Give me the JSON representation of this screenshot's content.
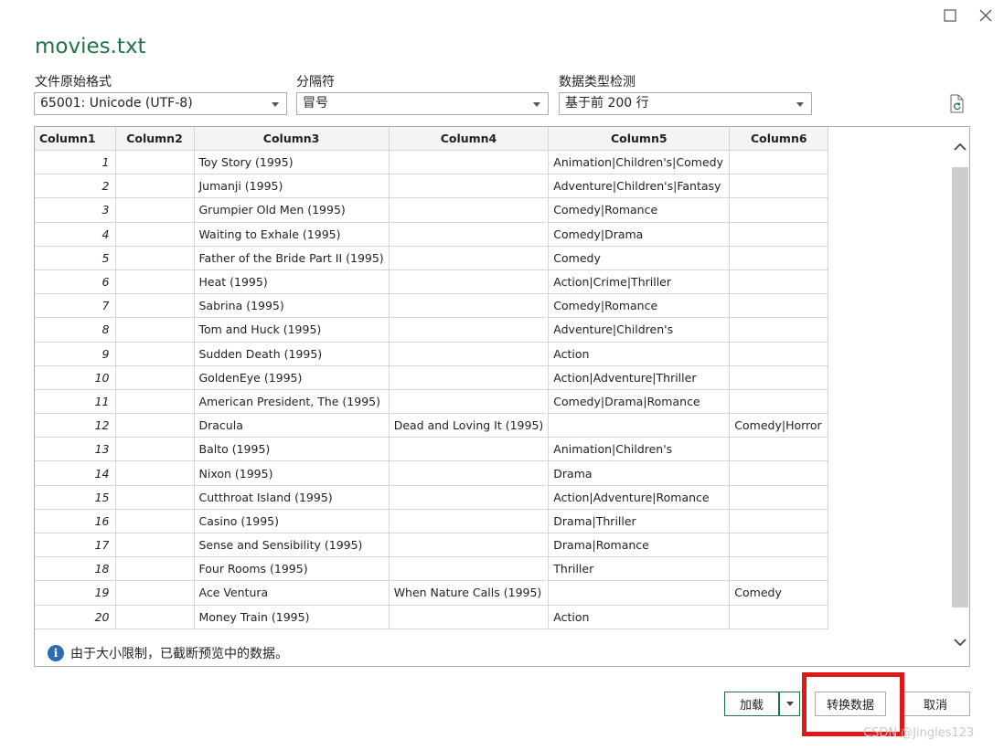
{
  "window": {
    "title": "movies.txt"
  },
  "fields": {
    "origin_label": "文件原始格式",
    "origin_value": "65001: Unicode (UTF-8)",
    "delimiter_label": "分隔符",
    "delimiter_value": "冒号",
    "detect_label": "数据类型检测",
    "detect_value": "基于前 200 行"
  },
  "table": {
    "headers": [
      "Column1",
      "Column2",
      "Column3",
      "Column4",
      "Column5",
      "Column6"
    ],
    "rows": [
      [
        "1",
        "",
        "Toy Story (1995)",
        "",
        "Animation|Children's|Comedy",
        ""
      ],
      [
        "2",
        "",
        "Jumanji (1995)",
        "",
        "Adventure|Children's|Fantasy",
        ""
      ],
      [
        "3",
        "",
        "Grumpier Old Men (1995)",
        "",
        "Comedy|Romance",
        ""
      ],
      [
        "4",
        "",
        "Waiting to Exhale (1995)",
        "",
        "Comedy|Drama",
        ""
      ],
      [
        "5",
        "",
        "Father of the Bride Part II (1995)",
        "",
        "Comedy",
        ""
      ],
      [
        "6",
        "",
        "Heat (1995)",
        "",
        "Action|Crime|Thriller",
        ""
      ],
      [
        "7",
        "",
        "Sabrina (1995)",
        "",
        "Comedy|Romance",
        ""
      ],
      [
        "8",
        "",
        "Tom and Huck (1995)",
        "",
        "Adventure|Children's",
        ""
      ],
      [
        "9",
        "",
        "Sudden Death (1995)",
        "",
        "Action",
        ""
      ],
      [
        "10",
        "",
        "GoldenEye (1995)",
        "",
        "Action|Adventure|Thriller",
        ""
      ],
      [
        "11",
        "",
        "American President, The (1995)",
        "",
        "Comedy|Drama|Romance",
        ""
      ],
      [
        "12",
        "",
        "Dracula",
        "Dead and Loving It (1995)",
        "",
        "Comedy|Horror"
      ],
      [
        "13",
        "",
        "Balto (1995)",
        "",
        "Animation|Children's",
        ""
      ],
      [
        "14",
        "",
        "Nixon (1995)",
        "",
        "Drama",
        ""
      ],
      [
        "15",
        "",
        "Cutthroat Island (1995)",
        "",
        "Action|Adventure|Romance",
        ""
      ],
      [
        "16",
        "",
        "Casino (1995)",
        "",
        "Drama|Thriller",
        ""
      ],
      [
        "17",
        "",
        "Sense and Sensibility (1995)",
        "",
        "Drama|Romance",
        ""
      ],
      [
        "18",
        "",
        "Four Rooms (1995)",
        "",
        "Thriller",
        ""
      ],
      [
        "19",
        "",
        "Ace Ventura",
        "When Nature Calls (1995)",
        "",
        "Comedy"
      ],
      [
        "20",
        "",
        "Money Train (1995)",
        "",
        "Action",
        ""
      ]
    ]
  },
  "notice": "由于大小限制，已截断预览中的数据。",
  "buttons": {
    "load": "加载",
    "transform": "转换数据",
    "cancel": "取消"
  },
  "watermark": "CSDN @Jingles123",
  "colors": {
    "accent": "#217346",
    "highlight": "#e21717"
  },
  "icons": [
    "maximize-icon",
    "close-icon",
    "refresh-icon",
    "info-icon",
    "chevron-up-icon",
    "chevron-down-icon"
  ]
}
